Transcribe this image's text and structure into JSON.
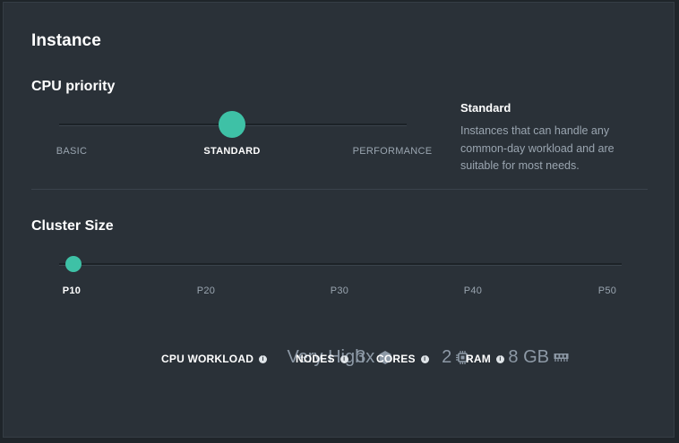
{
  "instance": {
    "title": "Instance"
  },
  "cpu_priority": {
    "title": "CPU priority",
    "options": [
      "BASIC",
      "STANDARD",
      "PERFORMANCE"
    ],
    "selected_index": 1,
    "description_title": "Standard",
    "description": "Instances that can handle any common-day workload and are suitable for most needs."
  },
  "cluster_size": {
    "title": "Cluster Size",
    "options": [
      "P10",
      "P20",
      "P30",
      "P40",
      "P50"
    ],
    "selected_index": 0
  },
  "specs": {
    "cpu_workload": {
      "label": "CPU WORKLOAD",
      "value": "Very High"
    },
    "nodes": {
      "label": "NODES",
      "value": "3x"
    },
    "cores": {
      "label": "CORES",
      "value": "2"
    },
    "ram": {
      "label": "RAM",
      "value": "8 GB"
    }
  },
  "icons": {
    "info": "info-icon",
    "nodes": "hexagon-icon",
    "cores": "cpu-chip-icon",
    "ram": "memory-icon"
  },
  "colors": {
    "accent": "#3ec1a6",
    "panel": "#2a3138",
    "background": "#1f252a",
    "muted_text": "#9aa5b0",
    "value_text": "#8d99a6"
  }
}
